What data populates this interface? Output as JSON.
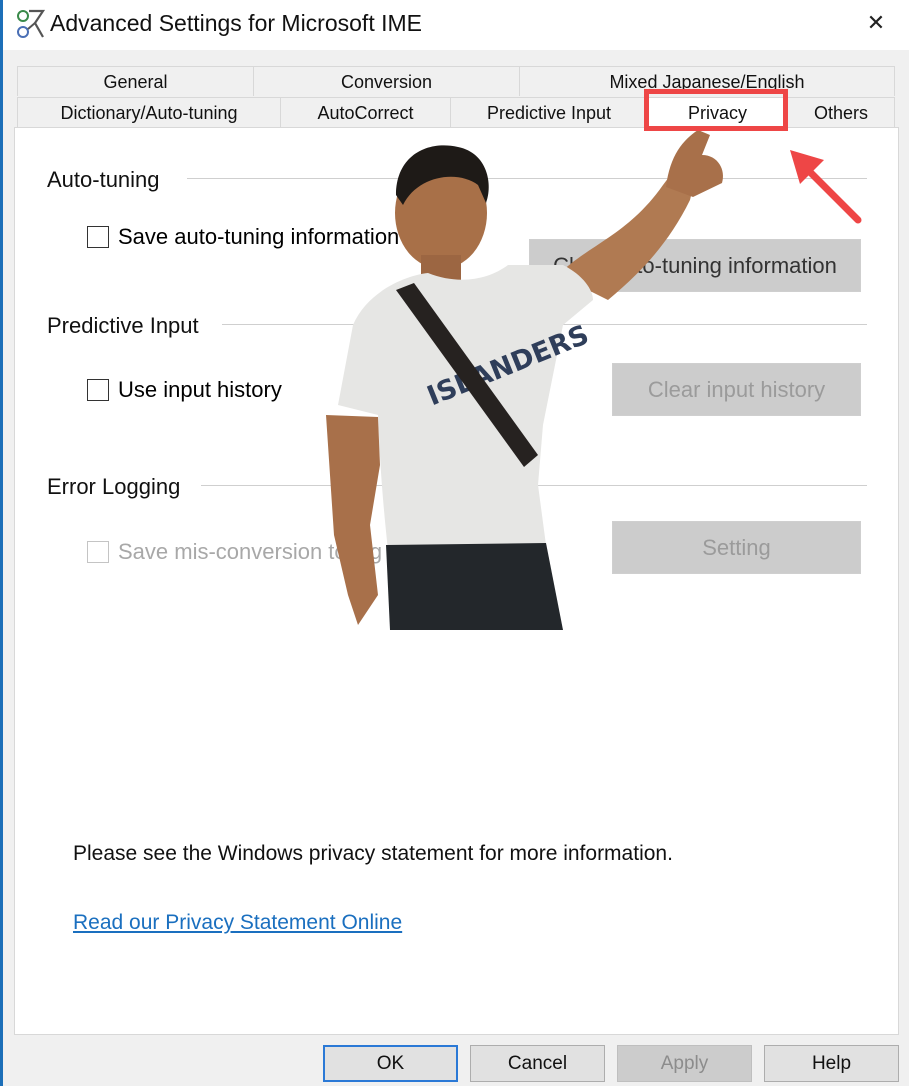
{
  "window": {
    "title": "Advanced Settings for Microsoft IME",
    "close_glyph": "✕"
  },
  "tabs": {
    "row1": [
      "General",
      "Conversion",
      "Mixed Japanese/English"
    ],
    "row2": [
      "Dictionary/Auto-tuning",
      "AutoCorrect",
      "Predictive Input",
      "Privacy",
      "Others"
    ],
    "active": "Privacy"
  },
  "sections": {
    "autotuning": {
      "title": "Auto-tuning",
      "checkbox_label": "Save auto-tuning information",
      "button_label": "Clear auto-tuning information"
    },
    "predictive": {
      "title": "Predictive Input",
      "checkbox_label": "Use input history",
      "button_label": "Clear input history"
    },
    "errorlog": {
      "title": "Error Logging",
      "checkbox_label": "Save mis-conversion to log",
      "button_label": "Setting"
    }
  },
  "notice": "Please see the Windows privacy statement for more information.",
  "privacy_link": "Read our Privacy Statement Online",
  "footer": {
    "ok": "OK",
    "cancel": "Cancel",
    "apply": "Apply",
    "help": "Help"
  },
  "overlay": {
    "shirt_text": "ISLANDERS"
  },
  "colors": {
    "highlight": "#ee4646",
    "link": "#1a6fbf",
    "accent": "#2b79d6"
  },
  "icons": [
    "app-ime-icon",
    "close-icon",
    "red-arrow-icon"
  ]
}
